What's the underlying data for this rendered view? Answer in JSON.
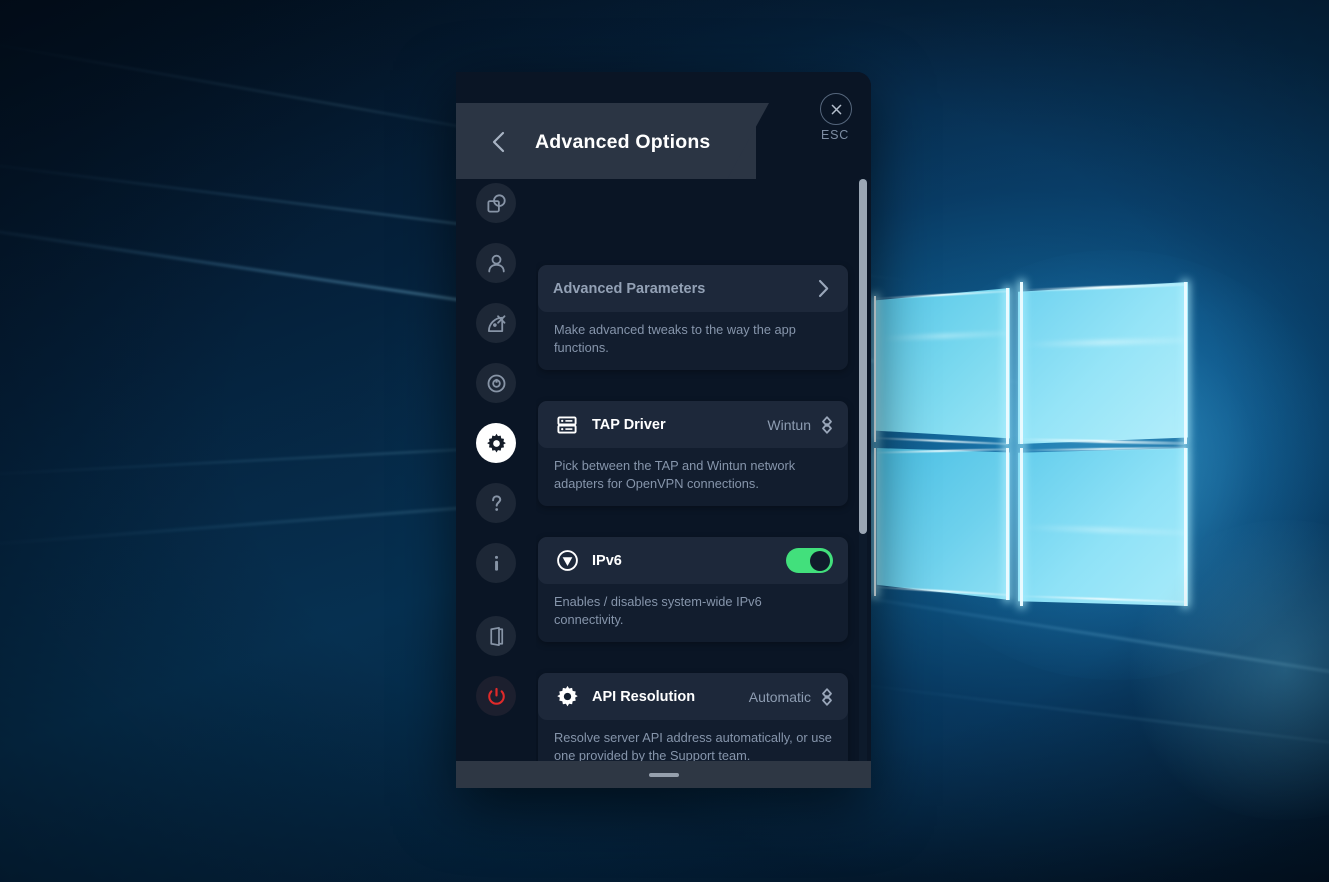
{
  "window": {
    "header": {
      "title": "Advanced Options",
      "back_icon": "chevron-left-icon",
      "close_icon": "close-circle-icon",
      "esc_label": "ESC"
    },
    "bottom_bar": {
      "handle": "drag-handle"
    }
  },
  "sidebar": {
    "items": [
      {
        "name": "sidebar-item-apps",
        "icon": "apps-shapes-icon",
        "active": false
      },
      {
        "name": "sidebar-item-account",
        "icon": "person-icon",
        "active": false
      },
      {
        "name": "sidebar-item-connection",
        "icon": "satellite-dish-icon",
        "active": false
      },
      {
        "name": "sidebar-item-kill-switch",
        "icon": "target-disc-icon",
        "active": false
      },
      {
        "name": "sidebar-item-settings",
        "icon": "gear-icon",
        "active": true
      },
      {
        "name": "sidebar-item-help",
        "icon": "question-mark-icon",
        "active": false
      },
      {
        "name": "sidebar-item-info",
        "icon": "info-icon",
        "active": false
      },
      {
        "name": "sidebar-item-logout",
        "icon": "exit-door-icon",
        "active": false
      },
      {
        "name": "sidebar-item-power",
        "icon": "power-icon",
        "active": false
      }
    ]
  },
  "settings": {
    "cards": [
      {
        "id": "advanced-parameters",
        "title": "Advanced Parameters",
        "icon": "",
        "control": "chevron-right",
        "value": "",
        "description": "Make advanced tweaks to the way the app functions."
      },
      {
        "id": "tap-driver",
        "title": "TAP Driver",
        "icon": "server-rack-icon",
        "control": "select",
        "value": "Wintun",
        "description": "Pick between the TAP and Wintun network adapters for OpenVPN connections."
      },
      {
        "id": "ipv6",
        "title": "IPv6",
        "icon": "navigation-circle-icon",
        "control": "toggle",
        "value": "on",
        "description": "Enables / disables system-wide IPv6 connectivity."
      },
      {
        "id": "api-resolution",
        "title": "API Resolution",
        "icon": "gear-icon",
        "control": "select",
        "value": "Automatic",
        "description": "Resolve server API address automatically, or use one provided by the Support team."
      },
      {
        "id": "partial-bottom-card",
        "title": "",
        "icon": "",
        "control": "toggle",
        "value": "on",
        "description": ""
      }
    ]
  },
  "colors": {
    "accent_green": "#42e07c",
    "header_bg": "#2b3544",
    "panel_bg": "#0a1525",
    "card_bg": "#121d2e",
    "card_row_highlight": "#1d283a",
    "power_red": "#e02a2a",
    "scrollbar_thumb": "#9aa6b4"
  }
}
